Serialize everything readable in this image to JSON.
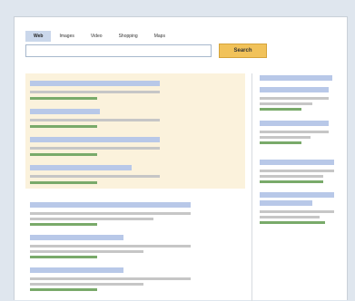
{
  "nav": {
    "tabs": [
      "Web",
      "Images",
      "Video",
      "Shopping",
      "Maps"
    ],
    "active_tab": "Web"
  },
  "search": {
    "query": "",
    "button_label": "Search"
  },
  "colors": {
    "page_background": "#dfe6ee",
    "ad_background": "#fbf2dc",
    "title_bar": "#b8c8e8",
    "snippet_bar": "#c6c6c6",
    "url_bar": "#79aa6a",
    "search_button": "#f1c25a"
  }
}
